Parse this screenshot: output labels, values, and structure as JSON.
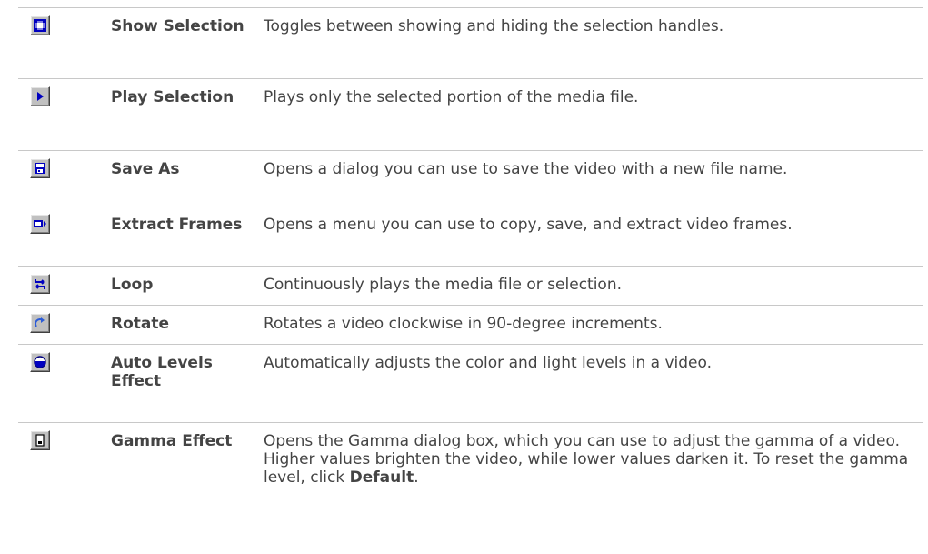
{
  "rows": [
    {
      "icon": "show-selection-icon",
      "name": "Show Selection",
      "description": "Toggles between showing and hiding the selection handles."
    },
    {
      "icon": "play-selection-icon",
      "name": "Play Selection",
      "description": "Plays only the selected portion of the media file."
    },
    {
      "icon": "save-as-icon",
      "name": "Save As",
      "description": "Opens a dialog you can use to save the video with a new file name."
    },
    {
      "icon": "extract-frames-icon",
      "name": "Extract Frames",
      "description": "Opens a menu you can use to copy, save, and extract video frames."
    },
    {
      "icon": "loop-icon",
      "name": "Loop",
      "description": "Continuously plays the media file or selection."
    },
    {
      "icon": "rotate-icon",
      "name": "Rotate",
      "description": "Rotates a video clockwise in 90-degree increments."
    },
    {
      "icon": "auto-levels-icon",
      "name": "Auto Levels Effect",
      "description": "Automatically adjusts the color and light levels in a video."
    },
    {
      "icon": "gamma-icon",
      "name": "Gamma Effect",
      "description": "Opens the Gamma dialog box, which you can use to adjust the gamma of a video. Higher values brighten the video, while lower values darken it. To reset the gamma level, click ",
      "description_bold": "Default",
      "description_end": "."
    }
  ],
  "colors": {
    "text": "#444444",
    "divider": "#c8c8c8",
    "icon_blue": "#0000c0",
    "button_face": "#c0c0c0"
  }
}
